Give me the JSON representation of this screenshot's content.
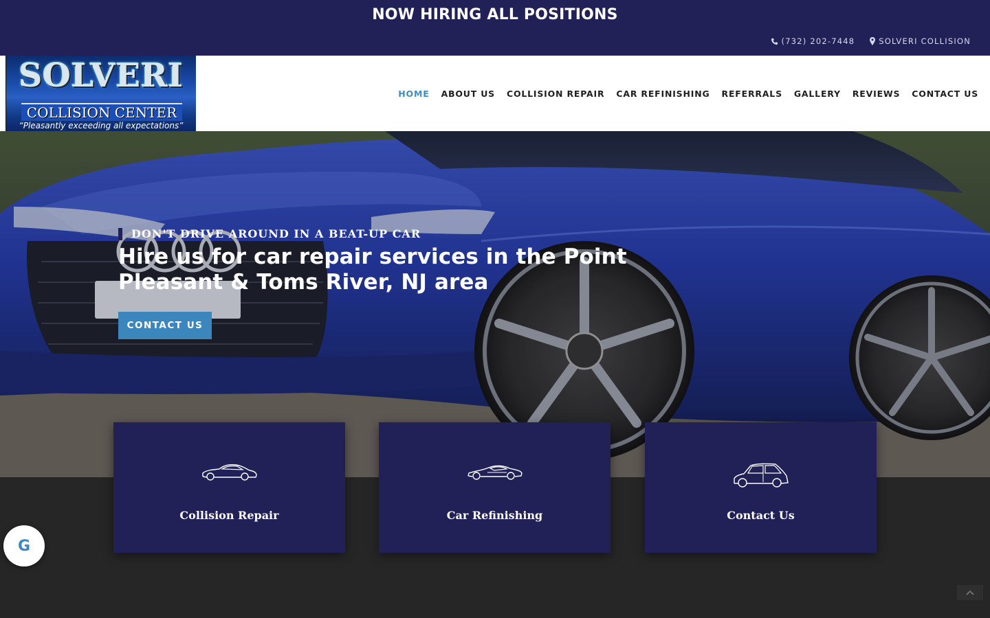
{
  "banner": {
    "hiring_text": "NOW HIRING ALL POSITIONS"
  },
  "top_info": {
    "phone": "(732) 202-7448",
    "location": "SOLVERI COLLISION"
  },
  "logo": {
    "title": "SOLVERI",
    "subtitle": "COLLISION CENTER",
    "tagline": "“Pleasantly exceeding all expectations”"
  },
  "nav": {
    "items": [
      {
        "label": "HOME",
        "active": true
      },
      {
        "label": "ABOUT US"
      },
      {
        "label": "COLLISION REPAIR"
      },
      {
        "label": "CAR REFINISHING"
      },
      {
        "label": "REFERRALS"
      },
      {
        "label": "GALLERY"
      },
      {
        "label": "REVIEWS"
      },
      {
        "label": "CONTACT US"
      }
    ]
  },
  "hero": {
    "kicker": "DON'T DRIVE AROUND IN A BEAT-UP CAR",
    "headline": "Hire us for car repair services in the Point Pleasant & Toms River, NJ area",
    "cta_label": "CONTACT US"
  },
  "cards": [
    {
      "label": "Collision Repair",
      "icon": "sports-car-icon"
    },
    {
      "label": "Car Refinishing",
      "icon": "supercar-icon"
    },
    {
      "label": "Contact Us",
      "icon": "hatchback-car-icon"
    }
  ],
  "widgets": {
    "google_badge": "G"
  },
  "colors": {
    "navy": "#212157",
    "accent_blue": "#3b87bd",
    "nav_active": "#3f8ec2",
    "footer_bg": "#262626"
  }
}
